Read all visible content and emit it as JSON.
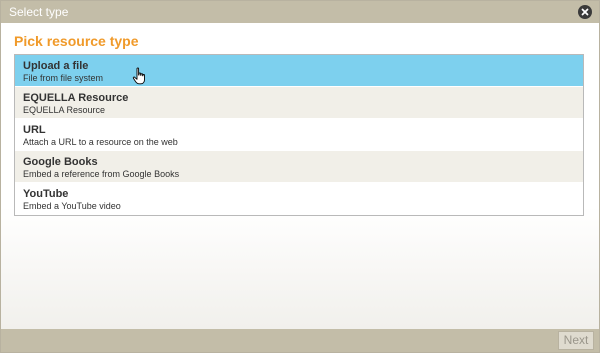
{
  "dialog": {
    "title": "Select type",
    "heading": "Pick resource type"
  },
  "types": [
    {
      "name": "Upload a file",
      "description": "File from file system"
    },
    {
      "name": "EQUELLA Resource",
      "description": "EQUELLA Resource"
    },
    {
      "name": "URL",
      "description": "Attach a URL to a resource on the web"
    },
    {
      "name": "Google Books",
      "description": "Embed a reference from Google Books"
    },
    {
      "name": "YouTube",
      "description": "Embed a YouTube video"
    }
  ],
  "footer": {
    "next_label": "Next"
  },
  "icons": {
    "close": "close-icon",
    "cursor": "hand-cursor-icon"
  },
  "colors": {
    "titlebar": "#c3bda8",
    "heading": "#f09a2a",
    "selected_row": "#7dd0ee",
    "alt_row": "#f1efe8"
  }
}
